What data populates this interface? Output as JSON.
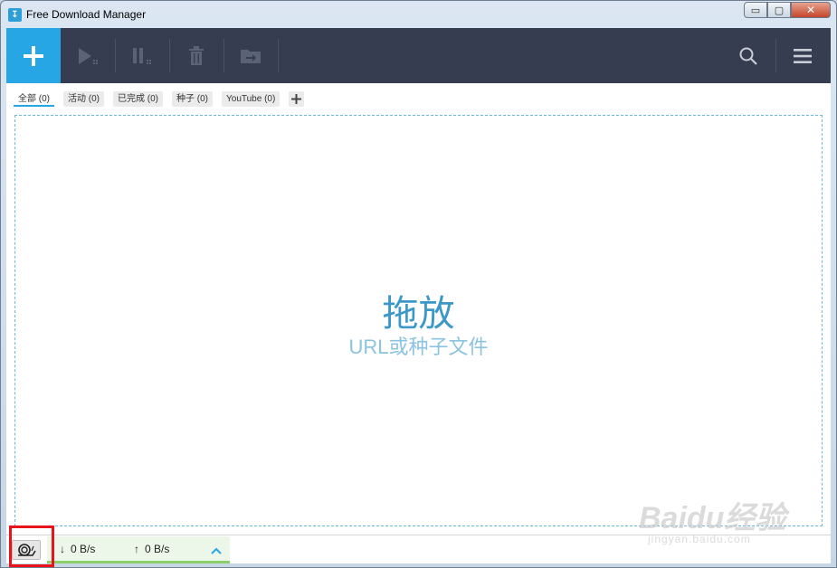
{
  "window": {
    "title": "Free Download Manager",
    "controls": {
      "minimize": "▭",
      "maximize": "▢",
      "close": "✕"
    }
  },
  "toolbar": {
    "add_icon": "plus-icon",
    "buttons": [
      {
        "name": "resume",
        "icon": "play-icon"
      },
      {
        "name": "pause",
        "icon": "pause-icon"
      },
      {
        "name": "delete",
        "icon": "trash-icon"
      },
      {
        "name": "move",
        "icon": "folder-move-icon"
      }
    ],
    "search_icon": "search-icon",
    "menu_icon": "hamburger-menu-icon"
  },
  "tabs": [
    {
      "label": "全部 (0)",
      "active": true
    },
    {
      "label": "活动 (0)",
      "active": false
    },
    {
      "label": "已完成 (0)",
      "active": false
    },
    {
      "label": "种子 (0)",
      "active": false
    },
    {
      "label": "YouTube (0)",
      "active": false
    }
  ],
  "dropzone": {
    "title": "拖放",
    "subtitle": "URL或种子文件"
  },
  "statusbar": {
    "download_arrow": "↓",
    "download_speed": "0 B/s",
    "upload_arrow": "↑",
    "upload_speed": "0 B/s"
  },
  "watermark": {
    "main": "Baidu经验",
    "sub": "jingyan.baidu.com"
  },
  "colors": {
    "accent": "#26a6e4",
    "toolbar_bg": "#363d50",
    "highlight_box": "#e8141c"
  }
}
